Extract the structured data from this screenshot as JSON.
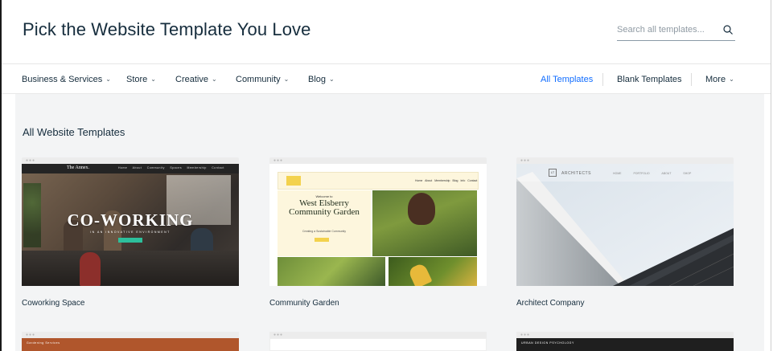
{
  "header": {
    "title": "Pick the Website Template You Love",
    "search_placeholder": "Search all templates..."
  },
  "nav": {
    "categories": [
      {
        "label": "Business & Services"
      },
      {
        "label": "Store"
      },
      {
        "label": "Creative"
      },
      {
        "label": "Community"
      },
      {
        "label": "Blog"
      }
    ],
    "right": {
      "all_templates": "All Templates",
      "blank_templates": "Blank Templates",
      "more": "More"
    },
    "active_color": "#116dff"
  },
  "main": {
    "section_title": "All Website Templates",
    "templates": [
      {
        "name": "Coworking Space",
        "preview": {
          "brand": "The Annex.",
          "menu": "Home About Community Spaces Membership Contact",
          "hero": "CO-WORKING",
          "sub": "IN AN INNOVATIVE ENVIRONMENT"
        }
      },
      {
        "name": "Community Garden",
        "preview": {
          "menu": "Home About Membership Blog Info Contact",
          "welcome": "Welcome to",
          "hero": "West Elsberry Community Garden",
          "sub": "Creating a Sustainable Community"
        }
      },
      {
        "name": "Architect Company",
        "preview": {
          "logo_mark": "LT",
          "brand": "ARCHITECTS",
          "menu": "HOME PORTFOLIO ABOUT SHOP"
        }
      }
    ],
    "second_row_peek": [
      {
        "label": "Gardening Services"
      },
      {
        "label": ""
      },
      {
        "label": "URBAN DESIGN PSYCHOLOGY"
      }
    ]
  },
  "icons": {
    "search": "search-icon",
    "chevron": "chevron-down-icon"
  }
}
